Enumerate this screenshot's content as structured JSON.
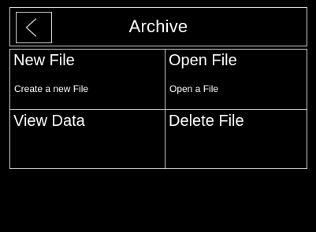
{
  "header": {
    "title": "Archive",
    "back_icon": "chevron-left-icon"
  },
  "menu": {
    "items": [
      {
        "label": "New File",
        "description": "Create a new File"
      },
      {
        "label": "Open File",
        "description": "Open a File"
      },
      {
        "label": "View Data",
        "description": ""
      },
      {
        "label": "Delete File",
        "description": ""
      }
    ]
  },
  "colors": {
    "background": "#000000",
    "border": "#cfcfcf",
    "text": "#ffffff"
  }
}
